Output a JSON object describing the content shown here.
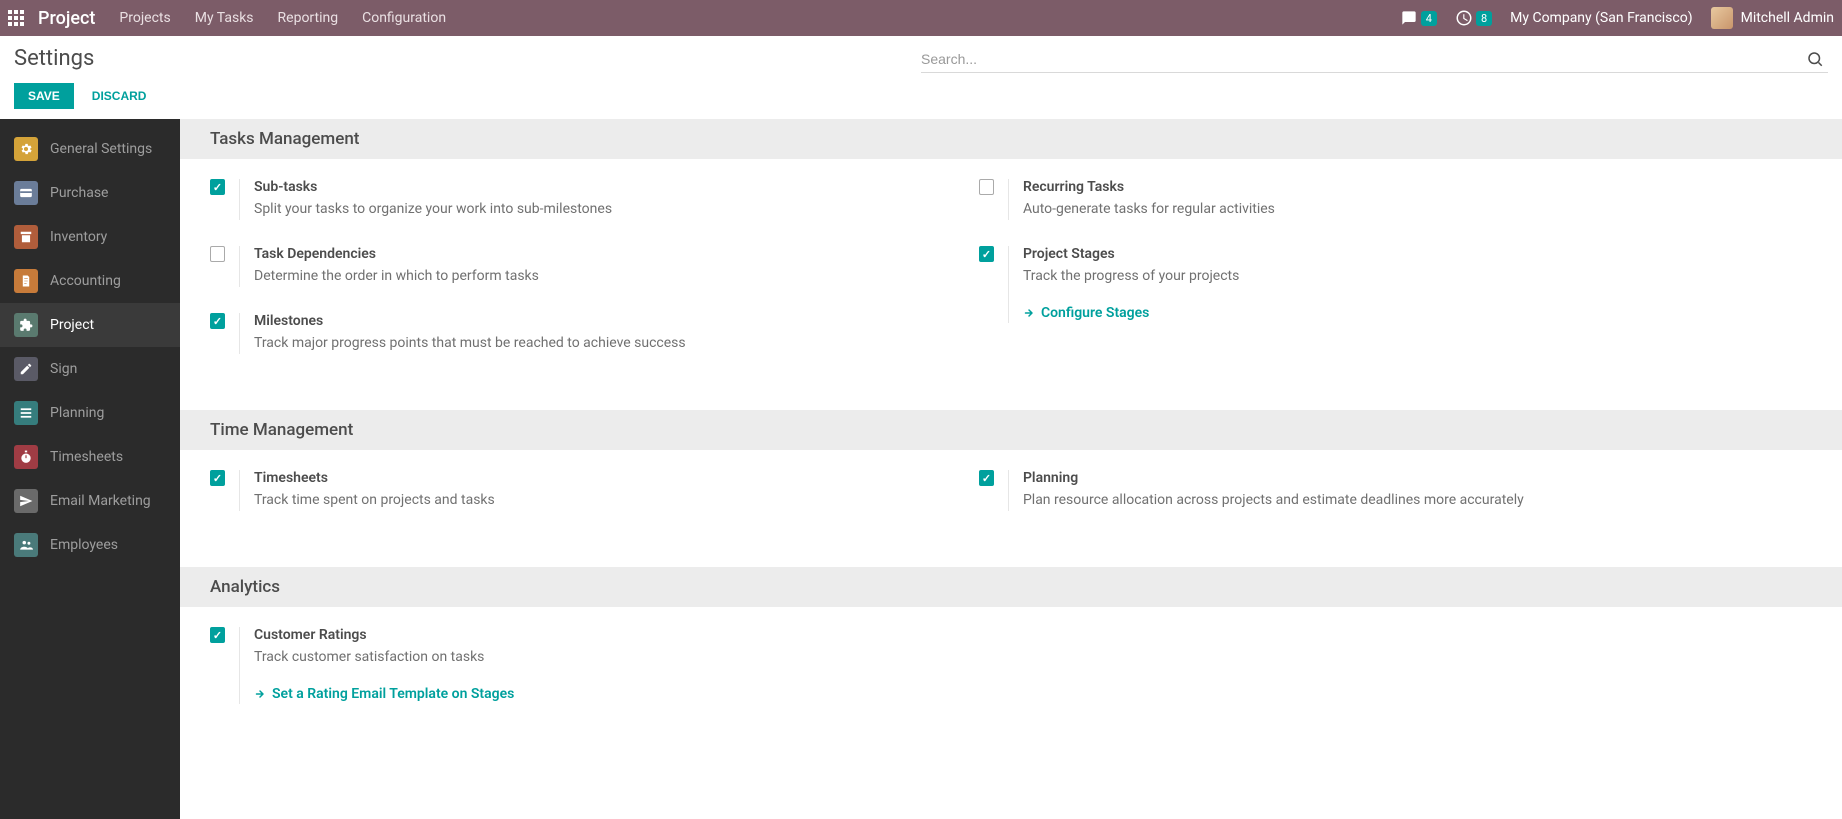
{
  "topbar": {
    "app_title": "Project",
    "menu": [
      "Projects",
      "My Tasks",
      "Reporting",
      "Configuration"
    ],
    "message_count": "4",
    "activity_count": "8",
    "company": "My Company (San Francisco)",
    "user": "Mitchell Admin"
  },
  "page": {
    "title": "Settings",
    "search_placeholder": "Search...",
    "save_label": "SAVE",
    "discard_label": "DISCARD"
  },
  "sidebar": {
    "items": [
      {
        "label": "General Settings",
        "color": "#d4a339",
        "icon": "gear"
      },
      {
        "label": "Purchase",
        "color": "#6b7d99",
        "icon": "credit-card"
      },
      {
        "label": "Inventory",
        "color": "#b05d3b",
        "icon": "archive"
      },
      {
        "label": "Accounting",
        "color": "#c77b3a",
        "icon": "invoice"
      },
      {
        "label": "Project",
        "color": "#5a7a6f",
        "icon": "puzzle",
        "active": true
      },
      {
        "label": "Sign",
        "color": "#5a5a66",
        "icon": "pencil"
      },
      {
        "label": "Planning",
        "color": "#367d7d",
        "icon": "tasks"
      },
      {
        "label": "Timesheets",
        "color": "#a03c44",
        "icon": "stopwatch"
      },
      {
        "label": "Email Marketing",
        "color": "#6a6a6a",
        "icon": "paper-plane"
      },
      {
        "label": "Employees",
        "color": "#4a7a7a",
        "icon": "users"
      }
    ]
  },
  "sections": [
    {
      "title": "Tasks Management",
      "left": [
        {
          "checked": true,
          "title": "Sub-tasks",
          "desc": "Split your tasks to organize your work into sub-milestones"
        },
        {
          "checked": false,
          "title": "Task Dependencies",
          "desc": "Determine the order in which to perform tasks"
        },
        {
          "checked": true,
          "title": "Milestones",
          "desc": "Track major progress points that must be reached to achieve success"
        }
      ],
      "right": [
        {
          "checked": false,
          "title": "Recurring Tasks",
          "desc": "Auto-generate tasks for regular activities"
        },
        {
          "checked": true,
          "title": "Project Stages",
          "desc": "Track the progress of your projects",
          "link": "Configure Stages"
        }
      ]
    },
    {
      "title": "Time Management",
      "left": [
        {
          "checked": true,
          "title": "Timesheets",
          "desc": "Track time spent on projects and tasks"
        }
      ],
      "right": [
        {
          "checked": true,
          "title": "Planning",
          "desc": "Plan resource allocation across projects and estimate deadlines more accurately"
        }
      ]
    },
    {
      "title": "Analytics",
      "left": [
        {
          "checked": true,
          "title": "Customer Ratings",
          "desc": "Track customer satisfaction on tasks",
          "link": "Set a Rating Email Template on Stages"
        }
      ],
      "right": []
    }
  ]
}
